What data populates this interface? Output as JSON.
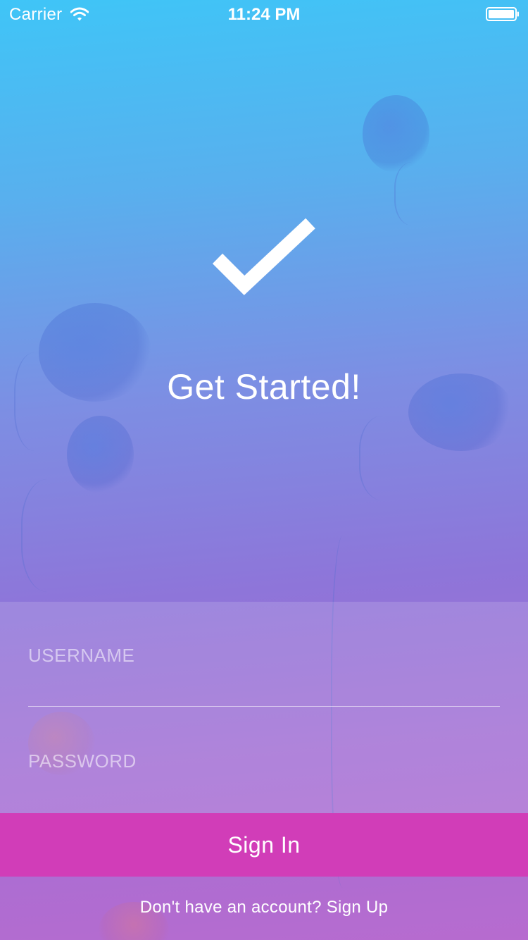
{
  "status_bar": {
    "carrier": "Carrier",
    "time": "11:24 PM",
    "wifi_icon": "wifi-icon",
    "battery_icon": "battery-icon"
  },
  "hero": {
    "icon": "checkmark-icon",
    "title": "Get Started!"
  },
  "form": {
    "username_placeholder": "USERNAME",
    "username_value": "",
    "password_placeholder": "PASSWORD",
    "password_value": ""
  },
  "actions": {
    "sign_in_label": "Sign In",
    "sign_up_prompt": "Don't have an account?",
    "sign_up_label": "Sign Up"
  },
  "colors": {
    "gradient_top": "#3fc5f7",
    "gradient_bottom": "#b76bcf",
    "sign_in_button": "#d13db8",
    "text": "#ffffff"
  }
}
